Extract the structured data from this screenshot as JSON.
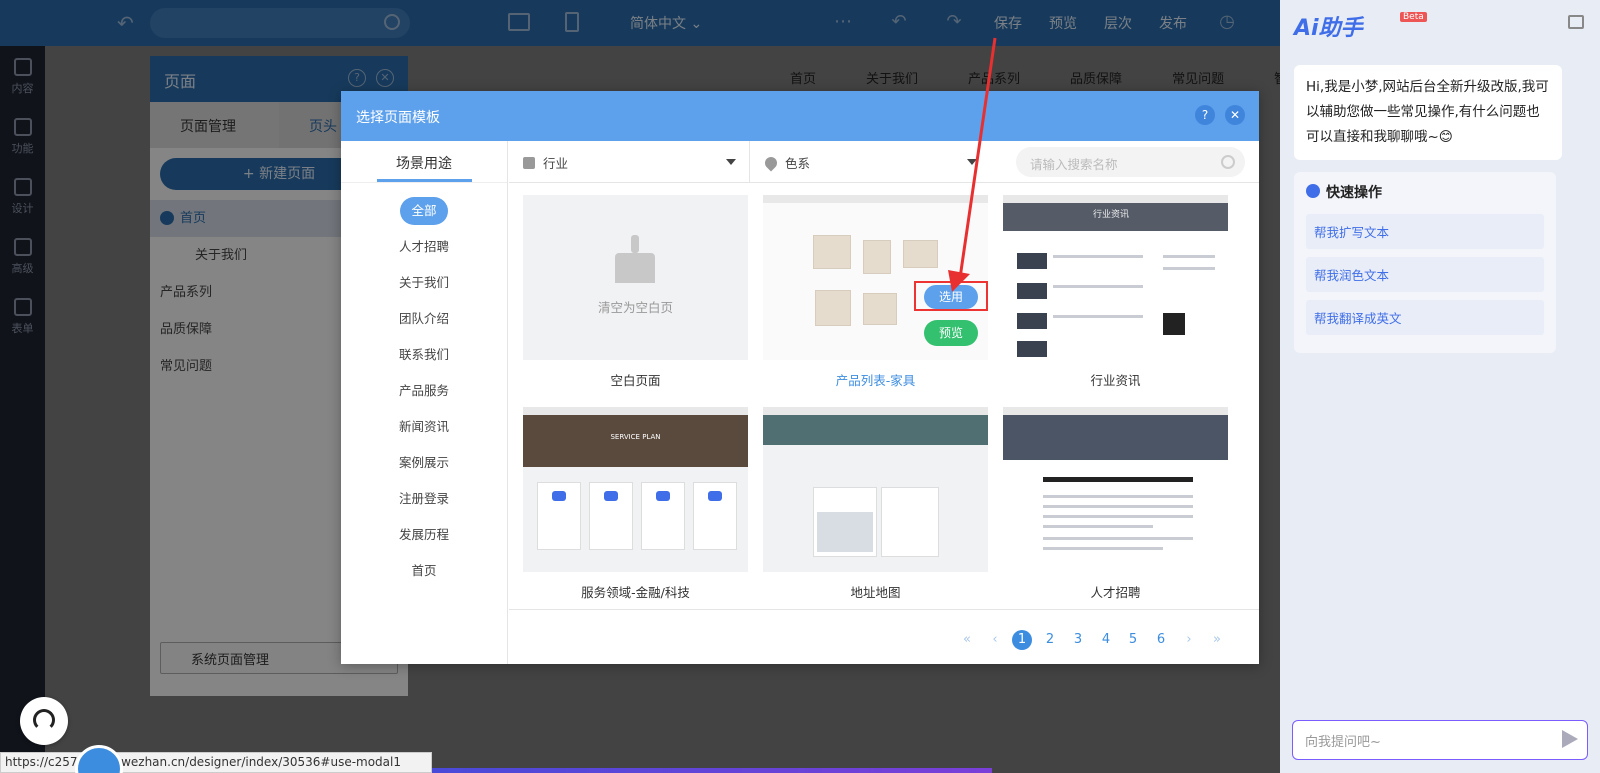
{
  "topbar": {
    "lang": "简体中文",
    "buttons": [
      "保存",
      "预览",
      "层次",
      "发布"
    ]
  },
  "rail": {
    "items": [
      "内容",
      "功能",
      "设计",
      "高级",
      "表单"
    ]
  },
  "pages_panel": {
    "title": "页面",
    "tab_manage": "页面管理",
    "tab_other": "页头",
    "new_page": "+ 新建页面",
    "items": [
      "首页",
      "关于我们",
      "产品系列",
      "品质保障",
      "常见问题"
    ],
    "system_btn": "系统页面管理"
  },
  "site_nav": [
    "首页",
    "关于我们",
    "产品系列",
    "品质保障",
    "常见问题",
    "智"
  ],
  "ai": {
    "logo": "Ai助手",
    "beta": "Beta",
    "greeting": "Hi,我是小梦,网站后台全新升级改版,我可以辅助您做一些常见操作,有什么问题也可以直接和我聊聊哦~😊",
    "quick_title": "快速操作",
    "quick_actions": [
      "帮我扩写文本",
      "帮我润色文本",
      "帮我翻译成英文"
    ],
    "ask_placeholder": "向我提问吧~"
  },
  "modal": {
    "title": "选择页面模板",
    "help": "?",
    "close": "✕",
    "sidebar_title": "场景用途",
    "categories": [
      "全部",
      "人才招聘",
      "关于我们",
      "团队介绍",
      "联系我们",
      "产品服务",
      "新闻资讯",
      "案例展示",
      "注册登录",
      "发展历程",
      "首页"
    ],
    "filter_industry": "行业",
    "filter_color": "色系",
    "search_placeholder": "请输入搜索名称",
    "cards": [
      {
        "caption": "空白页面",
        "blank_text": "清空为空白页"
      },
      {
        "caption": "产品列表-家具",
        "select": "选用",
        "preview": "预览"
      },
      {
        "caption": "行业资讯",
        "hero": "行业资讯"
      },
      {
        "caption": "服务领域-金融/科技",
        "hero": "SERVICE PLAN"
      },
      {
        "caption": "地址地图"
      },
      {
        "caption": "人才招聘"
      }
    ],
    "pages": [
      "1",
      "2",
      "3",
      "4",
      "5",
      "6"
    ],
    "current_page": "1"
  },
  "status_url": "https://c257       sy.scd.wezhan.cn/designer/index/30536#use-modal1"
}
